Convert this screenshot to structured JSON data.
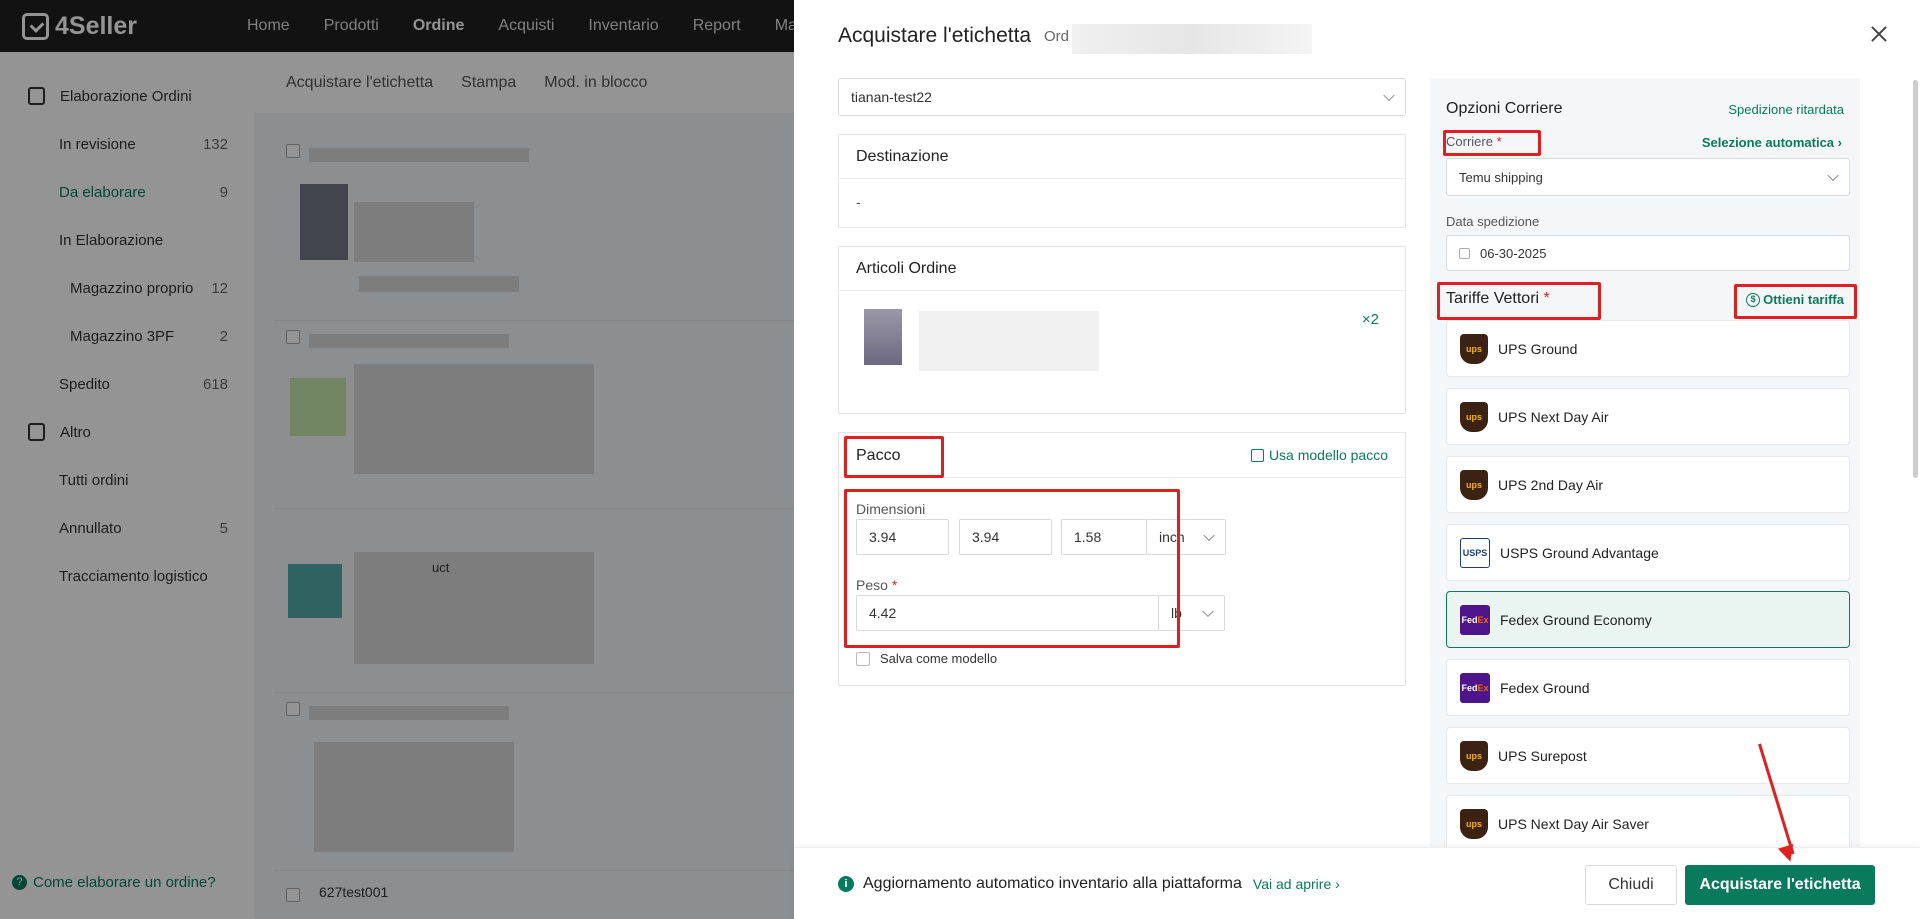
{
  "app": {
    "name": "4Seller"
  },
  "nav": [
    "Home",
    "Prodotti",
    "Ordine",
    "Acquisti",
    "Inventario",
    "Report",
    "Mar"
  ],
  "sidebar": {
    "group1": "Elaborazione Ordini",
    "items": [
      {
        "label": "In revisione",
        "count": "132"
      },
      {
        "label": "Da elaborare",
        "count": "9"
      },
      {
        "label": "In Elaborazione",
        "count": ""
      },
      {
        "label": "Magazzino proprio",
        "count": "12"
      },
      {
        "label": "Magazzino 3PF",
        "count": "2"
      },
      {
        "label": "Spedito",
        "count": "618"
      }
    ],
    "group2": "Altro",
    "items2": [
      {
        "label": "Tutti ordini",
        "count": ""
      },
      {
        "label": "Annullato",
        "count": "5"
      },
      {
        "label": "Tracciamento logistico",
        "count": ""
      }
    ],
    "help": "Come elaborare un ordine?"
  },
  "toolbar": {
    "buy_label": "Acquistare l'etichetta",
    "print": "Stampa",
    "bulk": "Mod. in blocco"
  },
  "list": {
    "partial_text": "uct",
    "last_order": "627test001"
  },
  "modal": {
    "title": "Acquistare l'etichetta",
    "order_prefix": "Ord",
    "store": "tianan-test22",
    "destination": {
      "title": "Destinazione",
      "value": "-"
    },
    "items": {
      "title": "Articoli Ordine",
      "qty": "×2"
    },
    "package": {
      "title": "Pacco",
      "template_link": "Usa modello pacco",
      "dimensions_label": "Dimensioni",
      "length": "3.94",
      "width": "3.94",
      "height": "1.58",
      "dim_unit": "inch",
      "weight_label": "Peso",
      "weight": "4.42",
      "weight_unit": "lb",
      "save_template": "Salva come modello"
    },
    "carrier_options": {
      "title": "Opzioni Corriere",
      "delayed": "Spedizione ritardata",
      "carrier_label": "Corriere",
      "auto_select": "Selezione automatica",
      "carrier_value": "Temu shipping",
      "ship_date_label": "Data spedizione",
      "ship_date": "06-30-2025",
      "rates_title": "Tariffe Vettori",
      "get_rate": "Ottieni tariffa"
    },
    "carriers": [
      {
        "name": "UPS Ground",
        "logo": "ups"
      },
      {
        "name": "UPS Next Day Air",
        "logo": "ups"
      },
      {
        "name": "UPS 2nd Day Air",
        "logo": "ups"
      },
      {
        "name": "USPS Ground Advantage",
        "logo": "usps"
      },
      {
        "name": "Fedex Ground Economy",
        "logo": "fedex",
        "selected": true
      },
      {
        "name": "Fedex Ground",
        "logo": "fedex"
      },
      {
        "name": "UPS Surepost",
        "logo": "ups"
      },
      {
        "name": "UPS Next Day Air Saver",
        "logo": "ups"
      }
    ],
    "footer": {
      "notice": "Aggiornamento automatico inventario alla piattaforma",
      "notice_link": "Vai ad aprire",
      "close": "Chiudi",
      "buy": "Acquistare l'etichetta"
    }
  },
  "logo_text": {
    "ups": "ups",
    "usps": "USPS",
    "fedex_fed": "Fed",
    "fedex_ex": "Ex"
  },
  "required_mark": "*",
  "colors": {
    "accent": "#0a7a5c",
    "annotation": "#e02020",
    "topbar": "#1f1f1f"
  }
}
